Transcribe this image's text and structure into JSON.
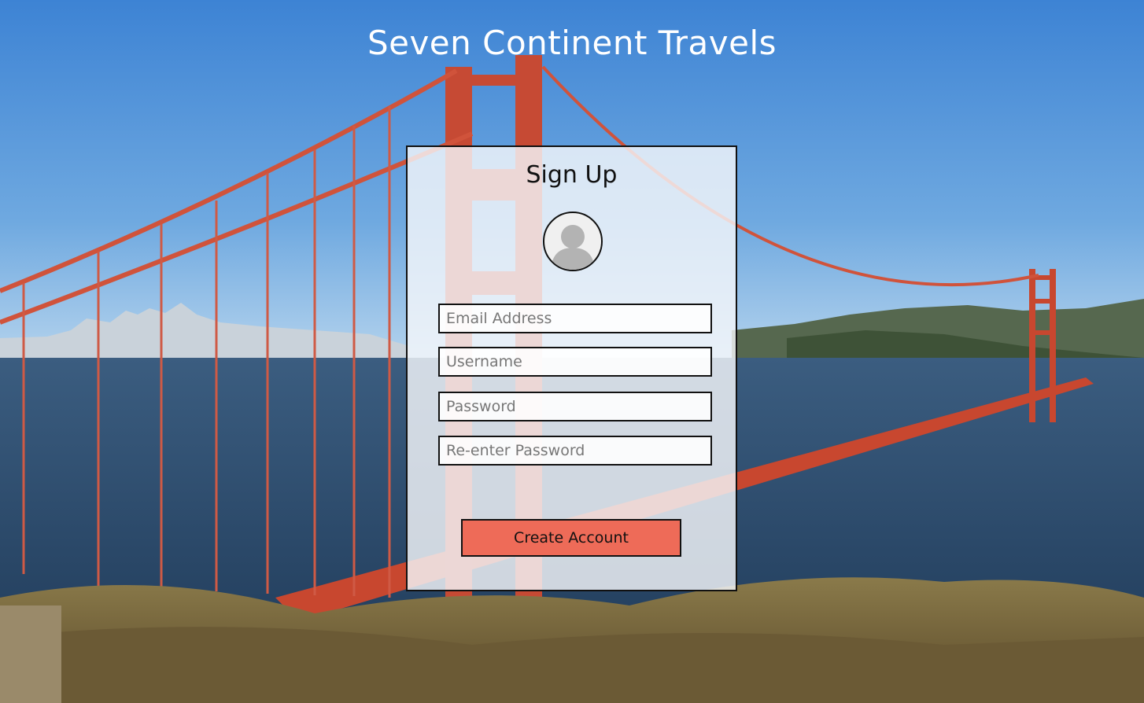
{
  "site": {
    "title": "Seven Continent Travels"
  },
  "signup": {
    "title": "Sign Up",
    "avatar_icon": "user-avatar-icon",
    "fields": {
      "email": {
        "placeholder": "Email Address",
        "value": ""
      },
      "username": {
        "placeholder": "Username",
        "value": ""
      },
      "password": {
        "placeholder": "Password",
        "value": ""
      },
      "reenter_password": {
        "placeholder": "Re-enter Password",
        "value": ""
      }
    },
    "create_button": "Create Account"
  },
  "colors": {
    "accent": "#ee6b58",
    "sky_top": "#3f86d6",
    "sky_bottom": "#a9cdeb",
    "water": "#2f4e6e",
    "bridge": "#d2503a"
  }
}
